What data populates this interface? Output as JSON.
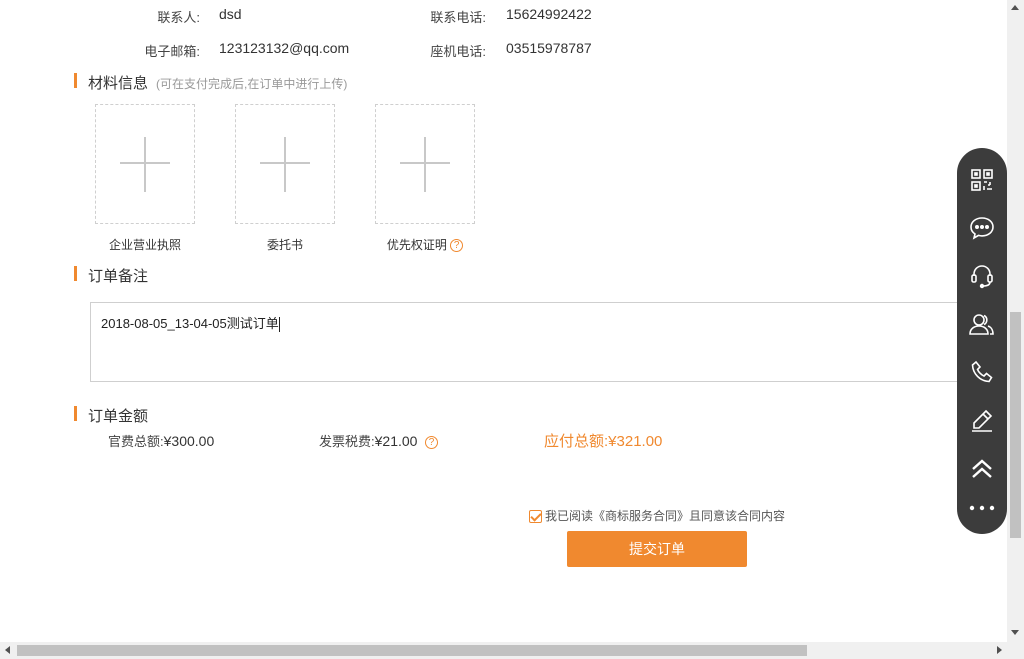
{
  "contact": {
    "contact_person_label": "联系人:",
    "contact_person_value": "dsd",
    "phone_label": "联系电话:",
    "phone_value": "15624992422",
    "email_label": "电子邮箱:",
    "email_value": "123123132@qq.com",
    "landline_label": "座机电话:",
    "landline_value": "03515978787"
  },
  "materials": {
    "title": "材料信息",
    "hint": "(可在支付完成后,在订单中进行上传)",
    "items": [
      {
        "label": "企业营业执照"
      },
      {
        "label": "委托书"
      },
      {
        "label": "优先权证明"
      }
    ],
    "help_glyph": "?"
  },
  "remark": {
    "title": "订单备注",
    "value": "2018-08-05_13-04-05测试订单"
  },
  "amount": {
    "title": "订单金额",
    "official_fee_label": "官费总额:",
    "official_fee_value": "¥300.00",
    "invoice_tax_label": "发票税费:",
    "invoice_tax_value": "¥21.00",
    "total_label": "应付总额:",
    "total_value": "¥321.00"
  },
  "agreement": {
    "text": "我已阅读《商标服务合同》且同意该合同内容",
    "checked": true
  },
  "submit_label": "提交订单",
  "float_bar": {
    "icons": [
      "qrcode-icon",
      "chat-icon",
      "customer-service-icon",
      "users-icon",
      "phone-icon",
      "edit-icon",
      "back-to-top-icon",
      "more-icon"
    ]
  },
  "colors": {
    "accent": "#f0892f",
    "float_bar_bg": "#3c3c3c"
  }
}
